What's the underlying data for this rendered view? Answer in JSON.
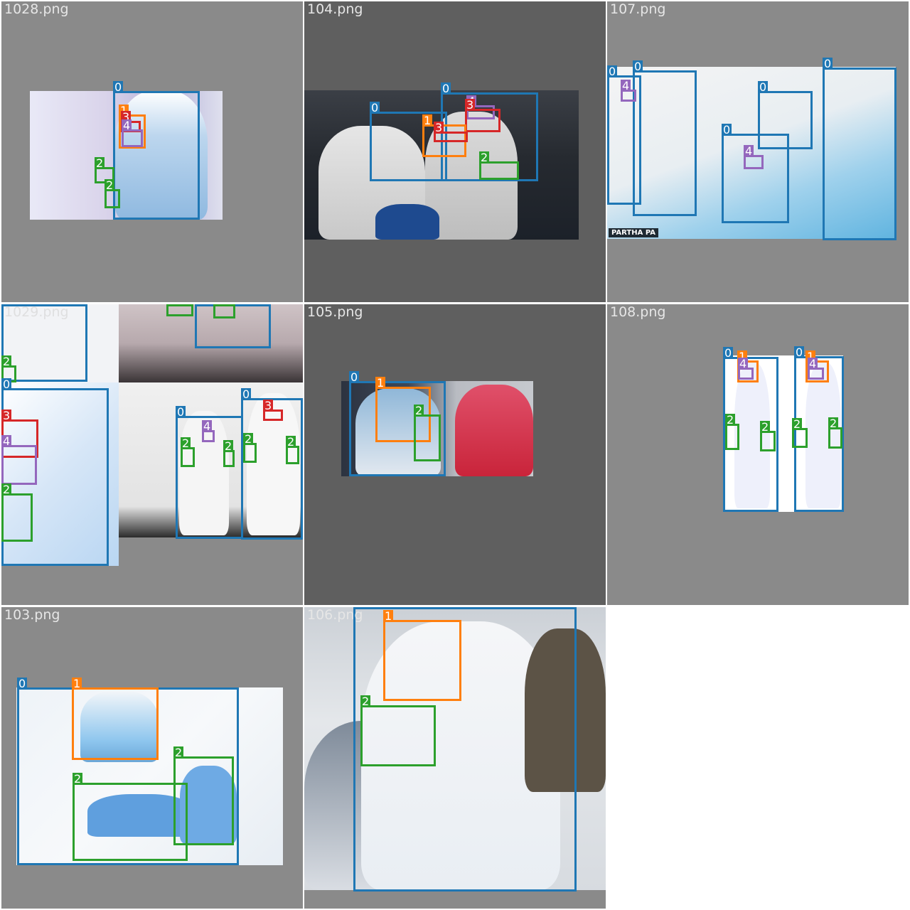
{
  "grid": {
    "background_color": "#8a8a8a",
    "class_colors": {
      "0": "#1f77b4",
      "1": "#ff7f0e",
      "2": "#2ca02c",
      "3": "#d62728",
      "4": "#9467bd"
    },
    "tiles": [
      {
        "filename": "1028.png",
        "labels": [
          "0",
          "1",
          "3",
          "4",
          "2",
          "2"
        ]
      },
      {
        "filename": "104.png",
        "labels": [
          "0",
          "0",
          "4",
          "3",
          "1",
          "3",
          "2"
        ]
      },
      {
        "filename": "107.png",
        "caption": "PARTHA PA",
        "labels": [
          "0",
          "0",
          "0",
          "0",
          "0",
          "4",
          "4"
        ]
      },
      {
        "filename": "1029.png",
        "labels": [
          "0",
          "2",
          "0",
          "2",
          "2",
          "0",
          "3",
          "4",
          "2",
          "0",
          "4",
          "2",
          "2",
          "0",
          "3",
          "2",
          "2"
        ]
      },
      {
        "filename": "105.png",
        "labels": [
          "0",
          "1",
          "2"
        ]
      },
      {
        "filename": "108.png",
        "labels": [
          "0",
          "1",
          "4",
          "2",
          "2",
          "0",
          "1",
          "4",
          "2",
          "2"
        ]
      },
      {
        "filename": "103.png",
        "labels": [
          "0",
          "1",
          "2",
          "2"
        ]
      },
      {
        "filename": "106.png",
        "labels": [
          "0",
          "1",
          "2"
        ]
      }
    ]
  }
}
